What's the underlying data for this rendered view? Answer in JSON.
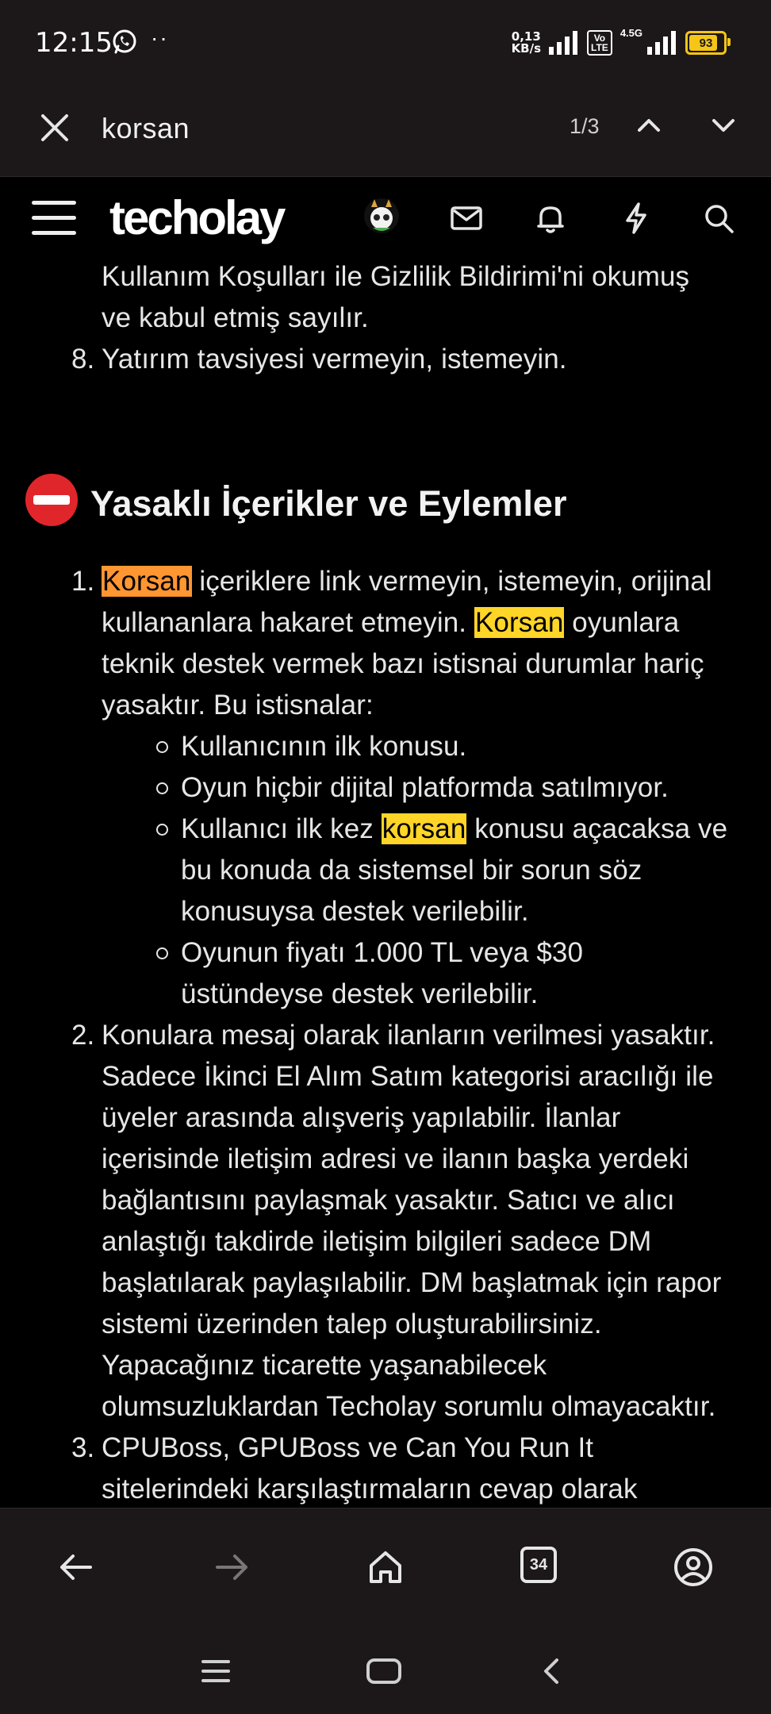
{
  "status_bar": {
    "time": "12:15",
    "dots": "··",
    "net_speed_value": "0,13",
    "net_speed_unit": "KB/s",
    "volte_top": "Vo",
    "volte_bottom": "LTE",
    "network": "4.5G",
    "battery": "93",
    "battery_level_percent": 93
  },
  "find_bar": {
    "query": "korsan",
    "match_count": "1/3"
  },
  "site_header": {
    "logo": "techolay"
  },
  "content": {
    "intro_lines": [
      "Kullanım Koşulları ile Gizlilik Bildirimi'ni okumuş",
      "ve kabul etmiş sayılır."
    ],
    "item8_number": "8.",
    "item8_text": "Yatırım tavsiyesi vermeyin, istemeyin.",
    "section_heading": "Yasaklı İçerikler ve Eylemler",
    "item1": {
      "number": "1.",
      "line1_hl": "Korsan",
      "line1_rest": " içeriklere link vermeyin, istemeyin, orijinal",
      "line2_pre": "kullananlara hakaret etmeyin. ",
      "line2_hl": "Korsan",
      "line2_rest": " oyunlara",
      "line3": "teknik destek vermek bazı istisnai durumlar hariç",
      "line4": "yasaktır. Bu istisnalar:",
      "sub1": "Kullanıcının ilk konusu.",
      "sub2": "Oyun hiçbir dijital platformda satılmıyor.",
      "sub3_pre": "Kullanıcı ilk kez ",
      "sub3_hl": "korsan",
      "sub3_rest": " konusu açacaksa ve",
      "sub3_line2": "bu konuda da sistemsel bir sorun söz",
      "sub3_line3": "konusuysa destek verilebilir.",
      "sub4_line1": "Oyunun fiyatı 1.000 TL veya $30",
      "sub4_line2": "üstündeyse destek verilebilir."
    },
    "item2": {
      "number": "2.",
      "lines": [
        "Konulara mesaj olarak ilanların verilmesi yasaktır.",
        "Sadece İkinci El Alım Satım kategorisi aracılığı ile",
        "üyeler arasında alışveriş yapılabilir. İlanlar",
        "içerisinde iletişim adresi ve ilanın başka yerdeki",
        "bağlantısını paylaşmak yasaktır. Satıcı ve alıcı",
        "anlaştığı takdirde iletişim bilgileri sadece DM",
        "başlatılarak paylaşılabilir. DM başlatmak için rapor",
        "sistemi üzerinden talep oluşturabilirsiniz.",
        "Yapacağınız ticarette yaşanabilecek",
        "olumsuzluklardan Techolay sorumlu olmayacaktır."
      ]
    },
    "item3": {
      "number": "3.",
      "lines": [
        "CPUBoss, GPUBoss ve Can You Run It",
        "sitelerindeki karşılaştırmaların cevap olarak"
      ]
    }
  },
  "bottom_nav": {
    "tab_count": "34"
  },
  "colors": {
    "bar_bg": "#1c1718",
    "current_match": "#ff9632",
    "other_match": "#ffd528",
    "battery": "#f5c518",
    "no_entry_red": "#e0262b"
  }
}
